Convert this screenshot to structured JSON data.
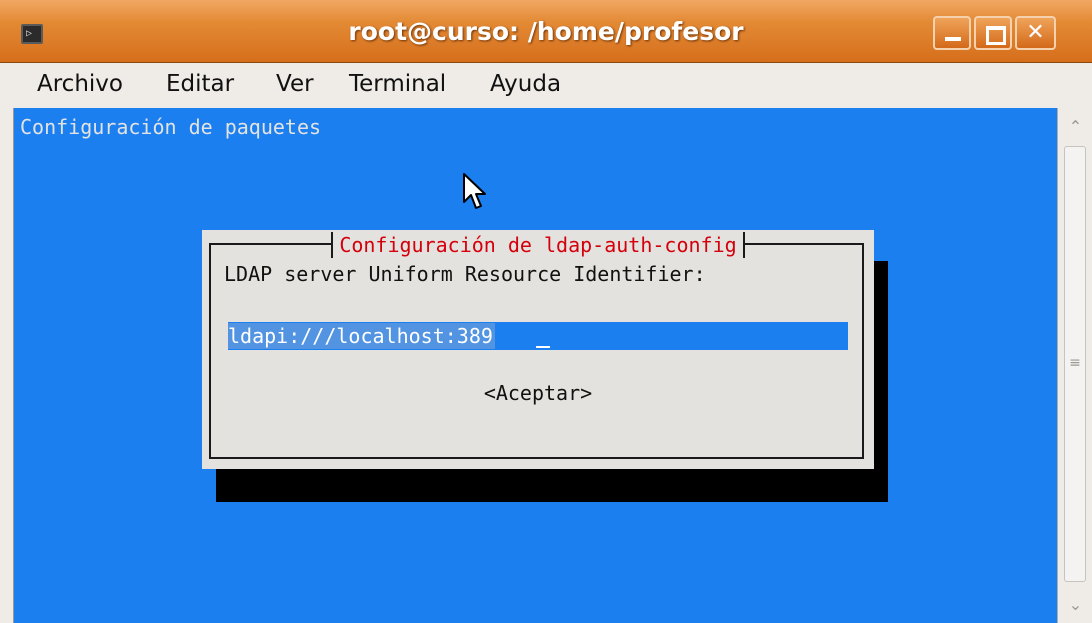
{
  "window": {
    "title": "root@curso: /home/profesor",
    "controls": {
      "minimize_icon": "minimize-icon",
      "maximize_icon": "maximize-icon",
      "close_icon": "close-icon",
      "close_glyph": "✕"
    },
    "app_icon_glyph": "▷"
  },
  "menubar": {
    "items": [
      "Archivo",
      "Editar",
      "Ver",
      "Terminal",
      "Ayuda"
    ]
  },
  "terminal": {
    "header": "Configuración de paquetes",
    "background": "#1c7ff0",
    "dialog": {
      "title": "Configuración de ldap-auth-config",
      "prompt": "LDAP server Uniform Resource Identifier:",
      "input_value": "ldapi:///localhost:389",
      "ok_button": "<Aceptar>",
      "title_color": "#d4000c"
    }
  },
  "scrollbar": {
    "up_glyph": "⌃",
    "down_glyph": "⌄",
    "grip_glyph": "≡"
  }
}
